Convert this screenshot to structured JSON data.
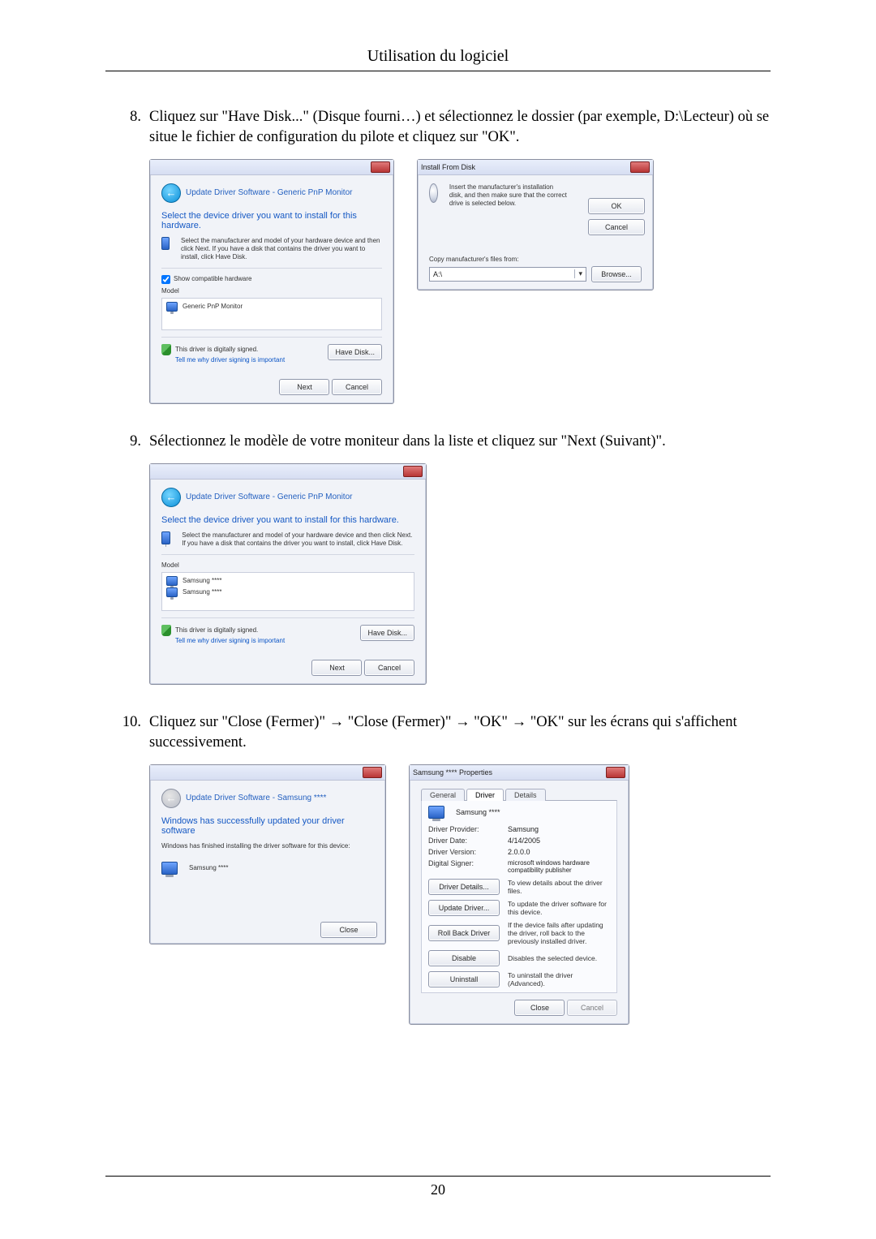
{
  "header": "Utilisation du logiciel",
  "page_number": "20",
  "steps": {
    "s8": {
      "num": "8.",
      "text": "Cliquez sur \"Have Disk...\" (Disque fourni…) et sélectionnez le dossier (par exemple, D:\\Lecteur) où se situe le fichier de configuration du pilote et cliquez sur \"OK\"."
    },
    "s9": {
      "num": "9.",
      "text": "Sélectionnez le modèle de votre moniteur dans la liste et cliquez sur \"Next (Suivant)\"."
    },
    "s10": {
      "num": "10.",
      "text": "Cliquez sur \"Close (Fermer)\" → \"Close (Fermer)\" → \"OK\" → \"OK\" sur les écrans qui s'affichent successivement."
    }
  },
  "dlg_update": {
    "crumb": "Update Driver Software - Generic PnP Monitor",
    "heading": "Select the device driver you want to install for this hardware.",
    "sub": "Select the manufacturer and model of your hardware device and then click Next. If you have a disk that contains the driver you want to install, click Have Disk.",
    "compat": "Show compatible hardware",
    "model_lbl": "Model",
    "model1": "Generic PnP Monitor",
    "signed": "This driver is digitally signed.",
    "tell": "Tell me why driver signing is important",
    "have_disk": "Have Disk...",
    "next": "Next",
    "cancel": "Cancel"
  },
  "dlg_install": {
    "title": "Install From Disk",
    "msg": "Insert the manufacturer's installation disk, and then make sure that the correct drive is selected below.",
    "copy": "Copy manufacturer's files from:",
    "path": "A:\\",
    "ok": "OK",
    "cancel": "Cancel",
    "browse": "Browse..."
  },
  "dlg_update2": {
    "crumb": "Update Driver Software - Generic PnP Monitor",
    "heading": "Select the device driver you want to install for this hardware.",
    "sub": "Select the manufacturer and model of your hardware device and then click Next. If you have a disk that contains the driver you want to install, click Have Disk.",
    "model_lbl": "Model",
    "model1": "Samsung ****",
    "model2": "Samsung ****",
    "signed": "This driver is digitally signed.",
    "tell": "Tell me why driver signing is important",
    "have_disk": "Have Disk...",
    "next": "Next",
    "cancel": "Cancel"
  },
  "dlg_done": {
    "crumb": "Update Driver Software - Samsung ****",
    "heading": "Windows has successfully updated your driver software",
    "sub": "Windows has finished installing the driver software for this device:",
    "device": "Samsung ****",
    "close": "Close"
  },
  "dlg_props": {
    "title": "Samsung **** Properties",
    "tab_general": "General",
    "tab_driver": "Driver",
    "tab_details": "Details",
    "device": "Samsung ****",
    "provider_l": "Driver Provider:",
    "provider_v": "Samsung",
    "date_l": "Driver Date:",
    "date_v": "4/14/2005",
    "ver_l": "Driver Version:",
    "ver_v": "2.0.0.0",
    "signer_l": "Digital Signer:",
    "signer_v": "microsoft windows hardware compatibility publisher",
    "b_details": "Driver Details...",
    "d_details": "To view details about the driver files.",
    "b_update": "Update Driver...",
    "d_update": "To update the driver software for this device.",
    "b_roll": "Roll Back Driver",
    "d_roll": "If the device fails after updating the driver, roll back to the previously installed driver.",
    "b_disable": "Disable",
    "d_disable": "Disables the selected device.",
    "b_uninstall": "Uninstall",
    "d_uninstall": "To uninstall the driver (Advanced).",
    "close": "Close",
    "cancel": "Cancel"
  }
}
